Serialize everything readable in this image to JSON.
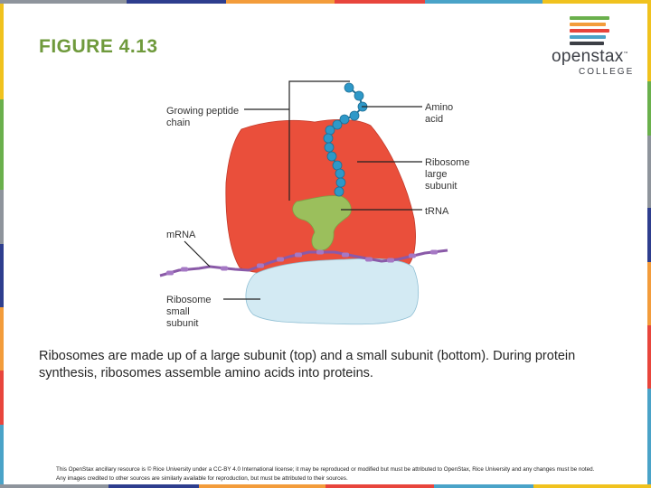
{
  "slide": {
    "title": "FIGURE 4.13",
    "caption": "Ribosomes are made up of a large subunit (top) and a small subunit (bottom). During protein synthesis, ribosomes assemble amino acids into proteins.",
    "footer_note": "This OpenStax ancillary resource is © Rice University under a CC-BY 4.0 International license; it may be reproduced or modified but must be attributed to OpenStax, Rice University and any changes must be noted. Any images credited to other sources are similarly available for reproduction, but must be attributed to their sources."
  },
  "logo": {
    "wordmark": "openstax",
    "trademark": "™",
    "subtitle": "COLLEGE",
    "stripe_colors": [
      "#6ab04c",
      "#f39c3b",
      "#e8453c",
      "#4aa3c8",
      "#3c3f46"
    ]
  },
  "diagram": {
    "labels": {
      "growing_chain_line1": "Growing peptide",
      "growing_chain_line2": "chain",
      "amino_acid_line1": "Amino",
      "amino_acid_line2": "acid",
      "large_subunit_line1": "Ribosome",
      "large_subunit_line2": "large",
      "large_subunit_line3": "subunit",
      "trna": "tRNA",
      "mrna": "mRNA",
      "small_subunit_line1": "Ribosome",
      "small_subunit_line2": "small",
      "small_subunit_line3": "subunit"
    },
    "colors": {
      "large_subunit": "#ea4f3b",
      "small_subunit": "#d3eaf3",
      "trna": "#9bbf5c",
      "amino_acid": "#2e98c8",
      "mrna": "#8a5aa8"
    }
  },
  "theme": {
    "edge_colors": [
      "#f0c21e",
      "#6ab04c",
      "#8e949c",
      "#2e3e8e",
      "#f39c3b",
      "#e8453c",
      "#4aa3c8"
    ]
  }
}
